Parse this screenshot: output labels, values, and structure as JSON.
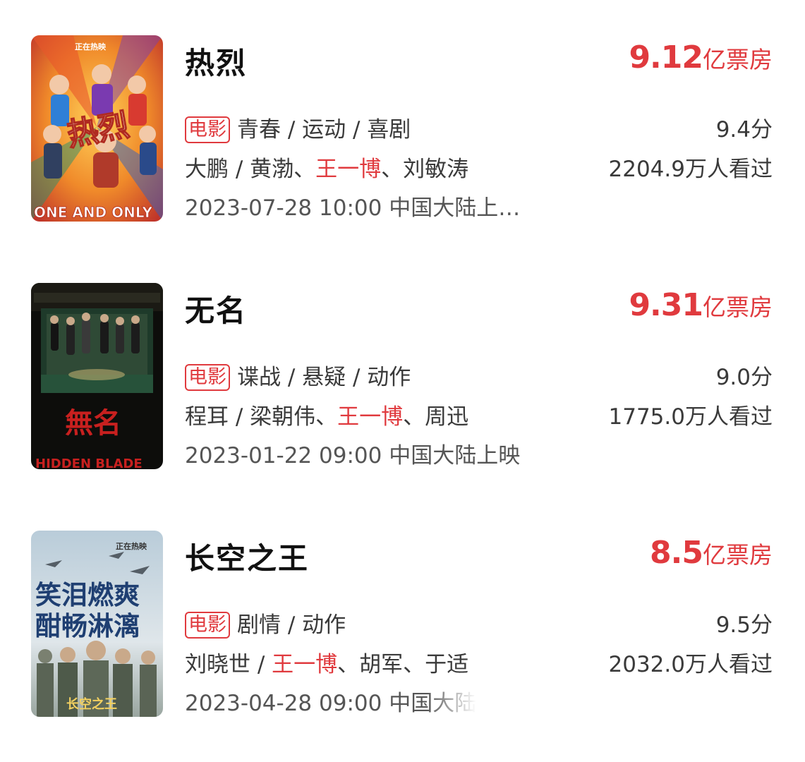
{
  "movies": [
    {
      "title": "热烈",
      "box_office_number": "9.12",
      "box_office_unit": "亿票房",
      "tag": "电影",
      "genres": "青春 / 运动 / 喜剧",
      "director": "大鹏",
      "sep": " / ",
      "cast_before": "黄渤、",
      "cast_highlight": "王一博",
      "cast_after": "、刘敏涛",
      "release": "2023-07-28 10:00 中国大陆上…",
      "score": "9.4分",
      "viewers": "2204.9万人看过",
      "poster": {
        "badge": "正在热映",
        "logo_text": "热烈",
        "bottom_text": "ONE AND ONLY",
        "bg_color": "#f0a32a",
        "accent": "#d63a2f"
      }
    },
    {
      "title": "无名",
      "box_office_number": "9.31",
      "box_office_unit": "亿票房",
      "tag": "电影",
      "genres": "谍战 / 悬疑 / 动作",
      "director": "程耳",
      "sep": " / ",
      "cast_before": "梁朝伟、",
      "cast_highlight": "王一博",
      "cast_after": "、周迅",
      "release": "2023-01-22 09:00 中国大陆上映",
      "score": "9.0分",
      "viewers": "1775.0万人看过",
      "poster": {
        "badge": "",
        "logo_text": "無名",
        "bottom_text": "HIDDEN BLADE",
        "bg_color": "#1a2a1f",
        "accent": "#c8201f"
      }
    },
    {
      "title": "长空之王",
      "box_office_number": "8.5",
      "box_office_unit": "亿票房",
      "tag": "电影",
      "genres": "剧情 / 动作",
      "director": "刘晓世",
      "sep": " / ",
      "cast_before": "",
      "cast_highlight": "王一博",
      "cast_after": "、胡军、于适",
      "release": "2023-04-28 09:00 中国大陆",
      "score": "9.5分",
      "viewers": "2032.0万人看过",
      "poster": {
        "badge": "正在热映",
        "headline_1": "笑泪燃爽",
        "headline_2": "酣畅淋漓",
        "logo_text": "长空之王",
        "bg_color": "#c9d6e0",
        "accent": "#1f3f72"
      }
    }
  ]
}
